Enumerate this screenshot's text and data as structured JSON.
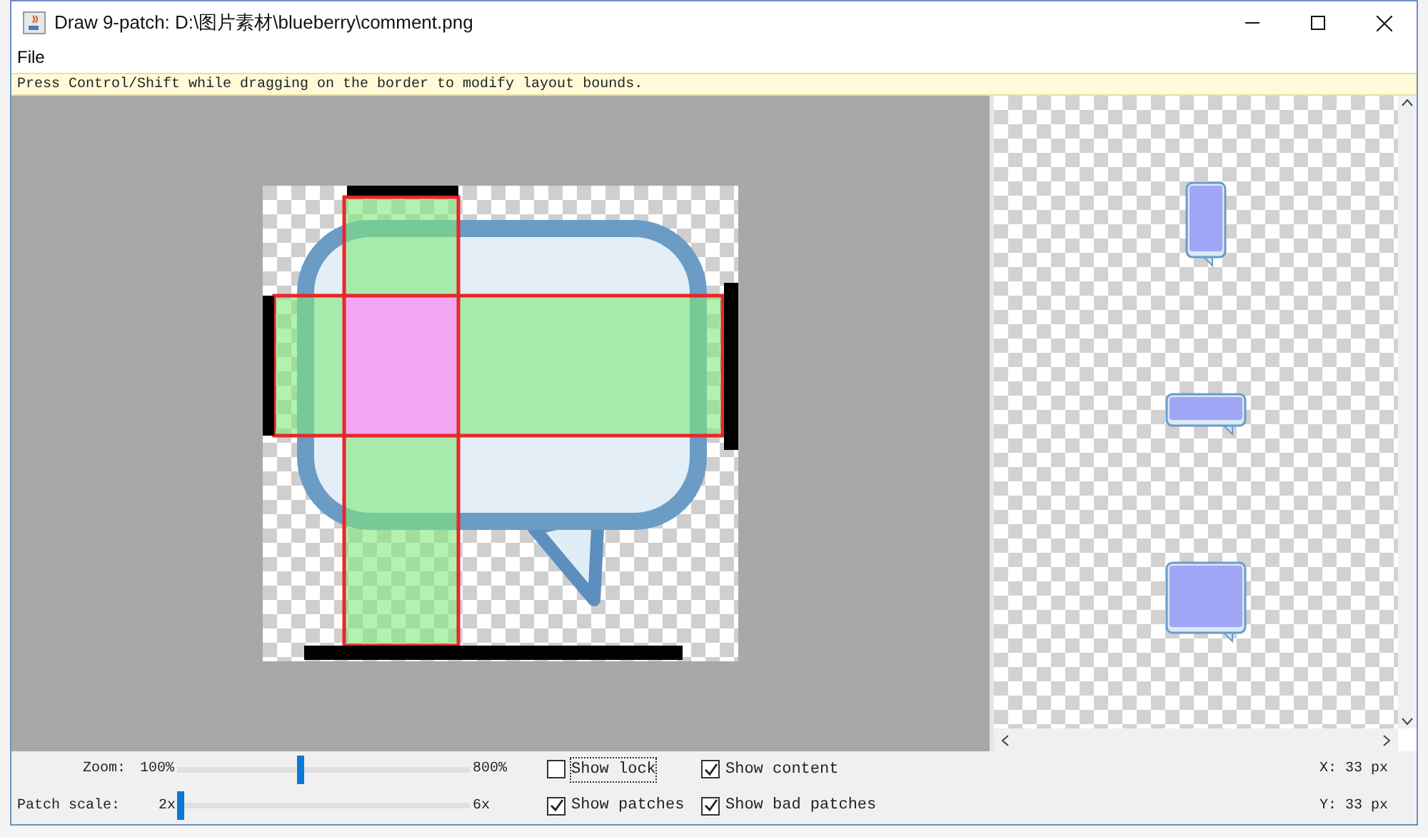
{
  "window": {
    "title": "Draw 9-patch: D:\\图片素材\\blueberry\\comment.png"
  },
  "menu": [
    "File"
  ],
  "hint": "Press Control/Shift while dragging on the border to modify layout bounds.",
  "controls": {
    "zoom": {
      "label": "Zoom:",
      "min": "100%",
      "max": "800%",
      "level": 0.42
    },
    "patch_scale": {
      "label": "Patch scale:",
      "min": "2x",
      "max": "6x",
      "level": 0
    },
    "checkboxes": [
      {
        "label": "Show lock",
        "checked": false,
        "focused": true
      },
      {
        "label": "Show content",
        "checked": true,
        "focused": false
      },
      {
        "label": "Show patches",
        "checked": true,
        "focused": false
      },
      {
        "label": "Show bad patches",
        "checked": true,
        "focused": false
      }
    ],
    "coords": [
      "X: 33 px",
      "Y: 33 px"
    ]
  }
}
